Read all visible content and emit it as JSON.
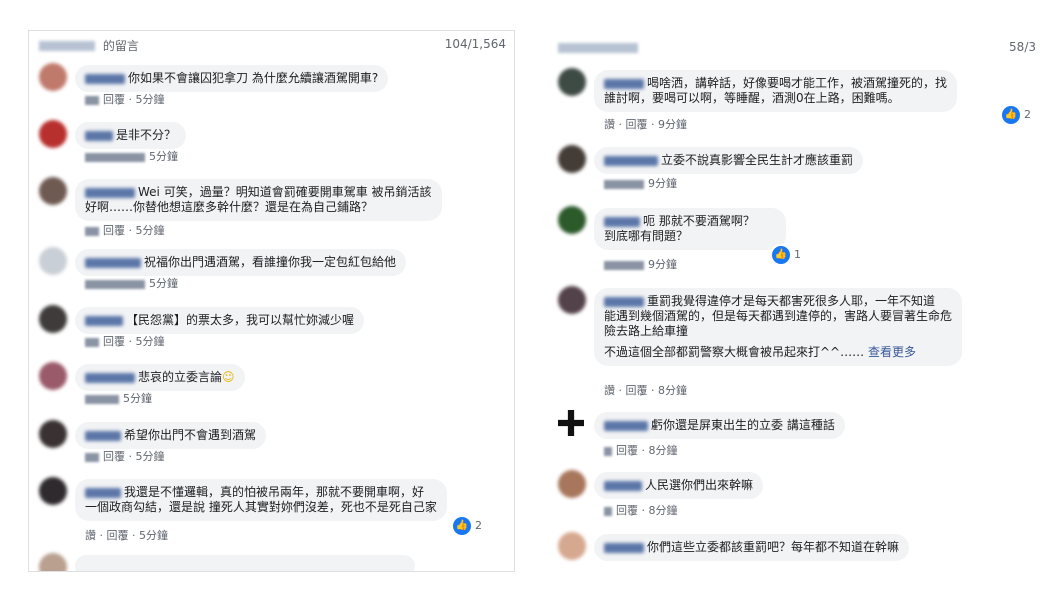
{
  "left": {
    "title": "的留言",
    "count": "104/1,564",
    "comments": [
      {
        "text": "你如果不會讓囚犯拿刀 為什麼允續讓酒駕開車?",
        "actions": "回覆 · 5分鐘"
      },
      {
        "text": "是非不分？",
        "actions": "5分鐘"
      },
      {
        "text": "Wei 可笑，過量？明知道會罰確要開車駕車 被吊銷活該",
        "text2": "好啊……你替他想這麼多幹什麼？還是在為自己鋪路？",
        "actions": "回覆 · 5分鐘"
      },
      {
        "text": "祝福你出門遇酒駕，看誰撞你我一定包紅包給他",
        "actions": "5分鐘"
      },
      {
        "text": "【民怨黨】的票太多，我可以幫忙妳減少喔",
        "actions": "回覆 · 5分鐘"
      },
      {
        "text": "悲哀的立委言論",
        "actions": "5分鐘"
      },
      {
        "text": "希望你出門不會遇到酒駕",
        "actions": "回覆 · 5分鐘"
      },
      {
        "text": "我還是不懂邏輯，真的怕被吊兩年，那就不要開車啊，好",
        "text2": "一個政商勾結，還是說 撞死人其實對妳們沒差，死也不是死自己家",
        "actions": "讚 · 回覆 · 5分鐘",
        "reactions": "2"
      }
    ]
  },
  "right": {
    "count": "58/3",
    "comments": [
      {
        "text": "喝啥洒，講幹話，好像要喝才能工作，被酒駕撞死的，找",
        "text2": "誰討啊，要喝可以啊，等睡醒，酒測0在上路，困難嗎。",
        "actions": "讚 · 回覆 · 9分鐘",
        "reactions": "2"
      },
      {
        "text": "立委不說真影響全民生計才應該重罰",
        "actions": "9分鐘"
      },
      {
        "text": "呃 那就不要酒駕啊？",
        "text2": "到底哪有問題？",
        "actions": "9分鐘",
        "reactions": "1"
      },
      {
        "text": "重罰我覺得違停才是每天都害死很多人耶，一年不知道",
        "text2": "能遇到幾個酒駕的，但是每天都遇到違停的，害路人要冒著生命危",
        "text3": "險去路上給車撞",
        "text4": "不過這個全部都罰警察大概會被吊起來打^^……",
        "more": "查看更多",
        "actions": "讚 · 回覆 · 8分鐘"
      },
      {
        "text": "虧你還是屏東出生的立委 講這種話",
        "actions": "回覆 · 8分鐘"
      },
      {
        "text": "人民選你們出來幹嘛",
        "actions": "回覆 · 8分鐘"
      },
      {
        "text": "你們這些立委都該重罰吧？每年都不知道在幹嘛"
      }
    ]
  },
  "colors": {
    "bubble": "#f2f3f5",
    "name_blur": "#5b76a8",
    "reaction": "#1877f2",
    "meta": "#606770"
  },
  "icons": {
    "reaction": "like-icon"
  }
}
